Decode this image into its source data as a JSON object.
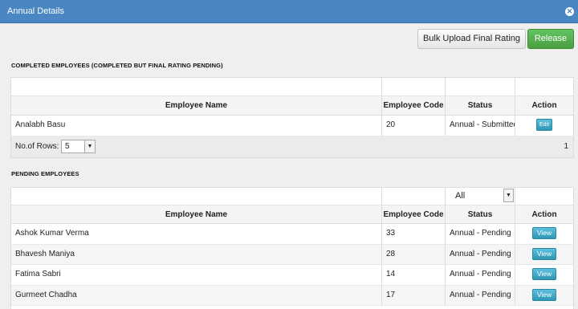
{
  "window": {
    "title": "Annual Details",
    "close_icon": "close-icon"
  },
  "toolbar": {
    "bulk_upload_label": "Bulk Upload Final Rating",
    "release_label": "Release"
  },
  "completed": {
    "section_title": "COMPLETED EMPLOYEES (COMPLETED BUT FINAL RATING PENDING)",
    "columns": [
      "Employee Name",
      "Employee Code",
      "Status",
      "Action"
    ],
    "rows": [
      {
        "name": "Analabh Basu",
        "code": "20",
        "status": "Annual - Submitted",
        "action": "Edit"
      }
    ],
    "pager": {
      "rows_label": "No.of Rows:",
      "rows_value": "5",
      "total": "1"
    }
  },
  "pending": {
    "section_title": "PENDING EMPLOYEES",
    "status_filter": "All",
    "columns": [
      "Employee Name",
      "Employee Code",
      "Status",
      "Action"
    ],
    "rows": [
      {
        "name": "Ashok Kumar Verma",
        "code": "33",
        "status": "Annual - Pending",
        "action": "View"
      },
      {
        "name": "Bhavesh Maniya",
        "code": "28",
        "status": "Annual - Pending",
        "action": "View"
      },
      {
        "name": "Fatima Sabri",
        "code": "14",
        "status": "Annual - Pending",
        "action": "View"
      },
      {
        "name": "Gurmeet Chadha",
        "code": "17",
        "status": "Annual - Pending",
        "action": "View"
      }
    ]
  }
}
